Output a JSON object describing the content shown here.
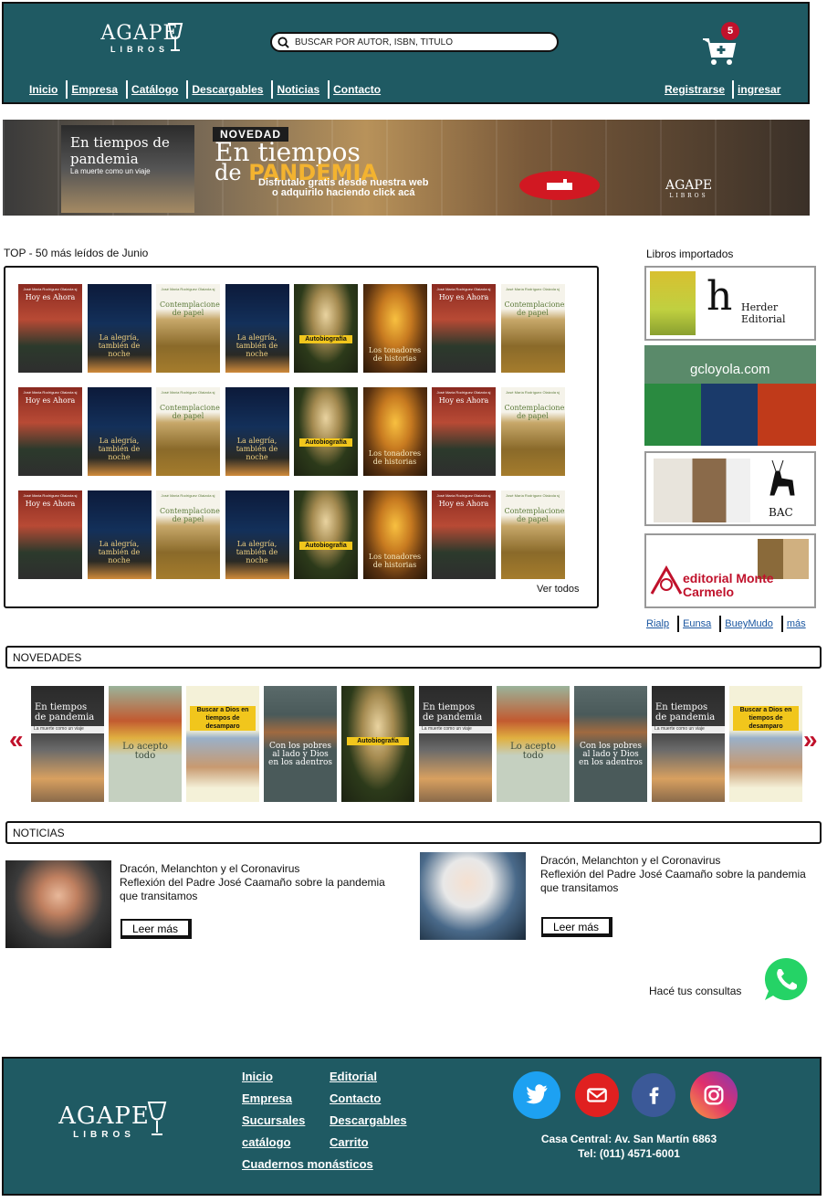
{
  "header": {
    "logo_name": "AGAPE",
    "logo_sub": "LIBROS",
    "search_placeholder": "BUSCAR POR AUTOR, ISBN, TITULO",
    "cart_count": "5",
    "nav": [
      "Inicio",
      "Empresa",
      "Catálogo",
      "Descargables",
      "Noticias",
      "Contacto"
    ],
    "user_nav": [
      "Registrarse",
      "ingresar"
    ]
  },
  "banner": {
    "book_title": "En tiempos de pandemia",
    "book_subtitle": "La muerte como un viaje",
    "tag": "NOVEDAD",
    "title_line1": "En tiempos",
    "title_line2_prefix": "de",
    "title_line2_highlight": "PANDEMIA",
    "cta_line1": "Disfrutalo gratis desde nuestra web",
    "cta_line2": "o adquirilo haciendo click acá",
    "logo_name": "AGAPE",
    "logo_sub": "LIBROS"
  },
  "top": {
    "title": "TOP - 50 más leídos de Junio",
    "see_all": "Ver todos",
    "author": "José María Rodríguez Olaizola sj",
    "books": [
      {
        "kind": "ora",
        "title": "Hoy es Ahora"
      },
      {
        "kind": "alegria",
        "title": "La alegría, también de noche"
      },
      {
        "kind": "contemp",
        "title": "Contemplaciones de papel"
      },
      {
        "kind": "alegria",
        "title": "La alegría, también de noche"
      },
      {
        "kind": "autobio",
        "title": "Autobiografía"
      },
      {
        "kind": "tonadas",
        "title": "Los tonadores de historias"
      },
      {
        "kind": "ora",
        "title": "Hoy es Ahora"
      },
      {
        "kind": "contemp",
        "title": "Contemplaciones de papel"
      }
    ]
  },
  "importados": {
    "title": "Libros importados",
    "publishers": [
      "Herder Editorial",
      "gcloyola.com",
      "BAC",
      "editorial Monte Carmelo"
    ],
    "links": [
      "Rialp",
      "Eunsa",
      "BueyMudo",
      "más"
    ]
  },
  "novedades": {
    "title": "NOVEDADES",
    "prev_icon": "«",
    "next_icon": "»",
    "books": [
      {
        "kind": "pand",
        "title": "En tiempos de pandemia",
        "sub": "La muerte como un viaje"
      },
      {
        "kind": "acepto",
        "title": "Lo acepto todo"
      },
      {
        "kind": "buscar",
        "title": "Buscar a Dios en tiempos de desamparo"
      },
      {
        "kind": "pobres",
        "title": "Con los pobres al lado y Dios en los adentros"
      },
      {
        "kind": "autobio",
        "title": "Autobiografía"
      },
      {
        "kind": "pand",
        "title": "En tiempos de pandemia",
        "sub": "La muerte como un viaje"
      },
      {
        "kind": "acepto",
        "title": "Lo acepto todo"
      },
      {
        "kind": "pobres",
        "title": "Con los pobres al lado y Dios en los adentros"
      },
      {
        "kind": "pand",
        "title": "En tiempos de pandemia",
        "sub": "La muerte como un viaje"
      },
      {
        "kind": "buscar",
        "title": "Buscar a Dios en tiempos de desamparo"
      }
    ]
  },
  "noticias": {
    "title": "NOTICIAS",
    "items": [
      {
        "line1": "Dracón, Melanchton y el Coronavirus",
        "line2": "Reflexión del Padre José Caamaño sobre la pandemia que transitamos",
        "button": "Leer más"
      },
      {
        "line1": "Dracón, Melanchton y el Coronavirus",
        "line2": "Reflexión del Padre José Caamaño sobre la pandemia que transitamos",
        "button": "Leer más"
      }
    ]
  },
  "consultas": "Hacé tus consultas",
  "footer": {
    "logo_name": "AGAPE",
    "logo_sub": "LIBROS",
    "col1": [
      "Inicio",
      "Empresa",
      "Sucursales",
      "catálogo",
      "Cuadernos monásticos"
    ],
    "col2": [
      "Editorial",
      "Contacto",
      "Descargables",
      "Carrito"
    ],
    "address": "Casa Central: Av. San Martín 6863",
    "phone": "Tel: (011) 4571-6001"
  },
  "colors": {
    "header_bg": "#1f5a63",
    "cart_badge": "#c0112b",
    "twitter": "#1da1f2",
    "mail": "#e02020",
    "facebook": "#3b5998",
    "instagram": "#c13584",
    "whatsapp": "#25d366"
  }
}
